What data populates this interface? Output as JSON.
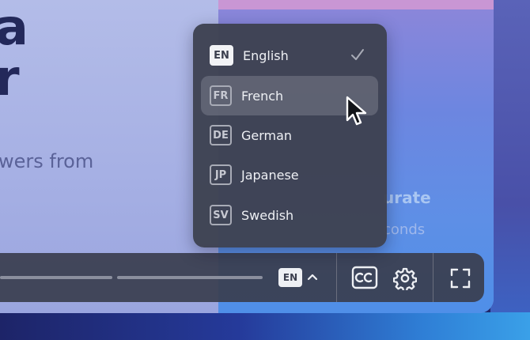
{
  "background": {
    "heading_line_1": "a",
    "heading_line_2": "r",
    "subtext": "wers from",
    "right_heading": "urate",
    "right_subtext": "conds"
  },
  "player": {
    "progress_fraction": 0.0,
    "language_badge": "EN",
    "cc_icon": "closed-captions-icon",
    "settings_icon": "gear-icon",
    "fullscreen_icon": "fullscreen-icon"
  },
  "language_menu": {
    "selected": "English",
    "hovered": "French",
    "items": [
      {
        "code": "EN",
        "label": "English"
      },
      {
        "code": "FR",
        "label": "French"
      },
      {
        "code": "DE",
        "label": "German"
      },
      {
        "code": "JP",
        "label": "Japanese"
      },
      {
        "code": "SV",
        "label": "Swedish"
      }
    ]
  },
  "colors": {
    "menu_bg": "#3e4252",
    "control_bar_bg": "#3a3e4e",
    "text_primary": "#eef0f4",
    "badge_bg": "#eef0f4"
  }
}
